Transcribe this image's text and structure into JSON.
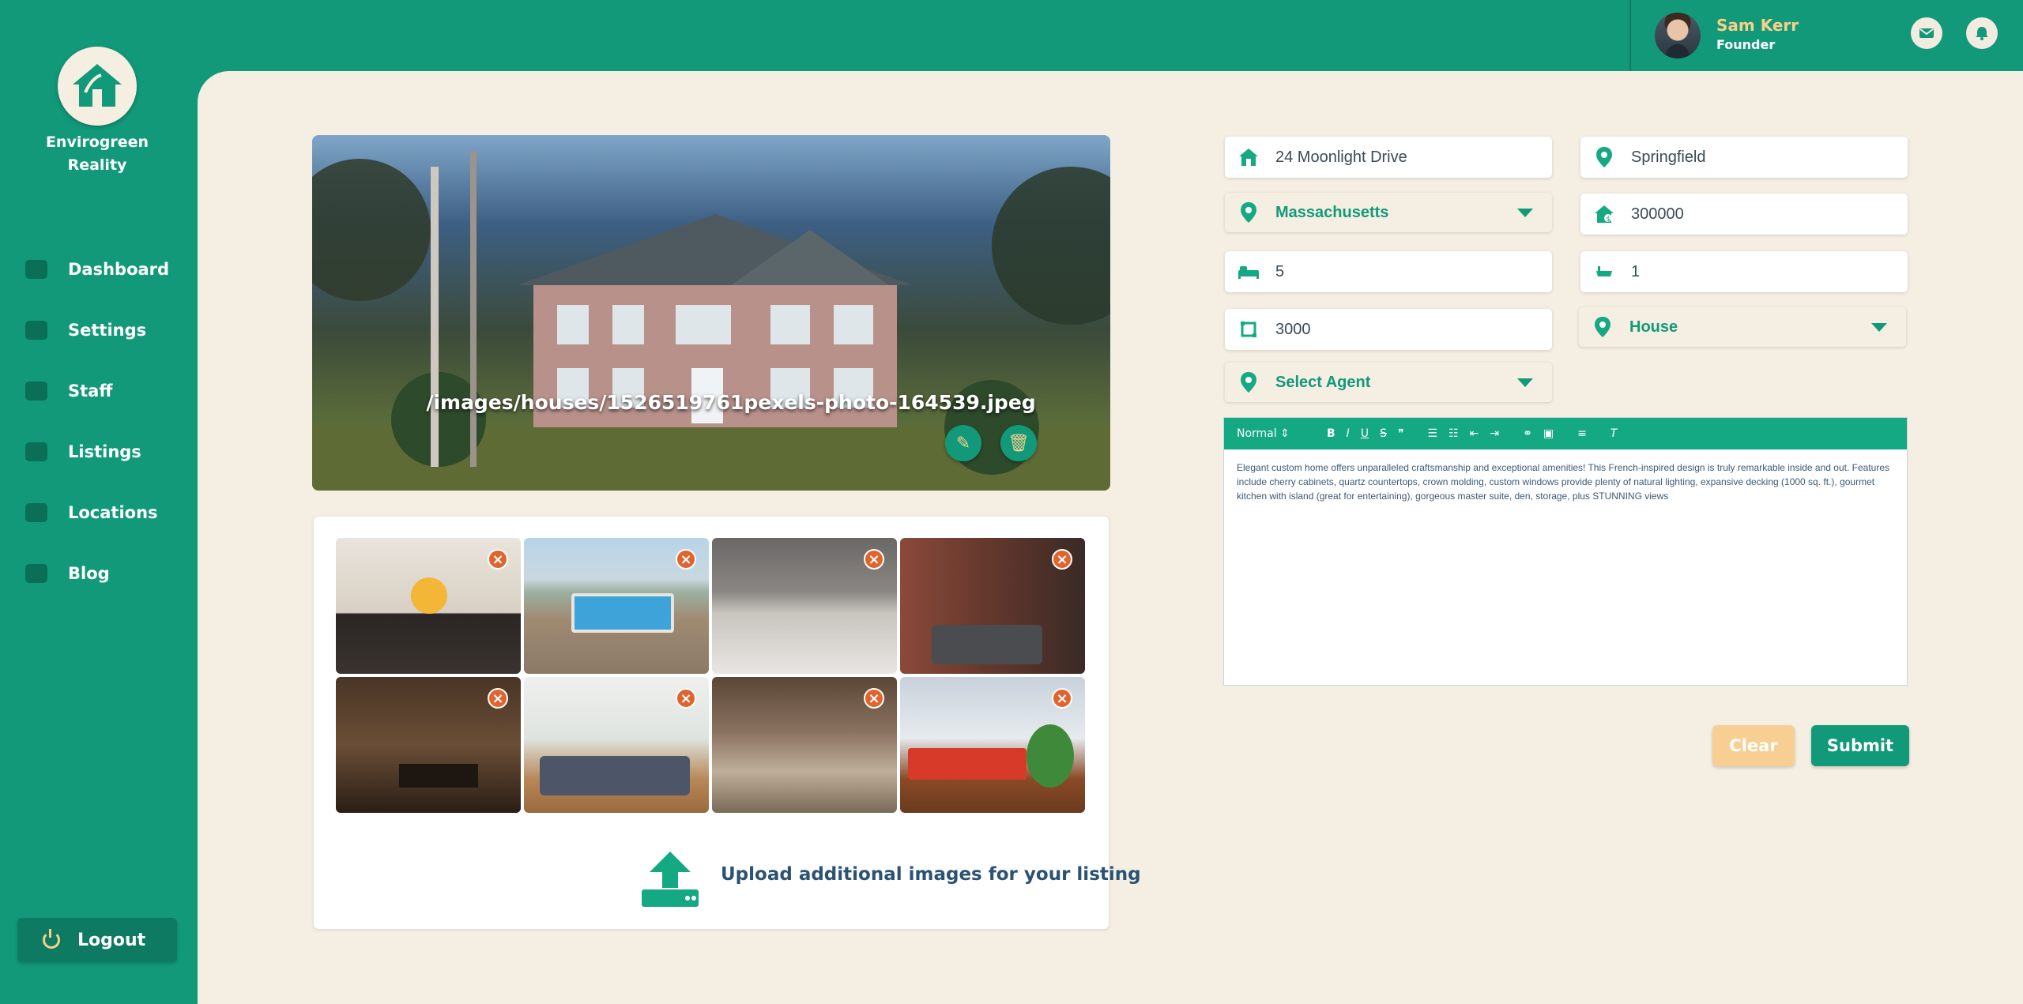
{
  "app": {
    "brand": "Envirogreen Reality",
    "brand_line1": "Envirogreen",
    "brand_line2": "Reality"
  },
  "user": {
    "name": "Sam Kerr",
    "role": "Founder"
  },
  "header_icons": [
    "mail-icon",
    "bell-icon"
  ],
  "sidebar": {
    "items": [
      {
        "label": "Dashboard",
        "icon": "dashboard-icon"
      },
      {
        "label": "Settings",
        "icon": "gear-icon"
      },
      {
        "label": "Staff",
        "icon": "user-icon"
      },
      {
        "label": "Listings",
        "icon": "house-icon"
      },
      {
        "label": "Locations",
        "icon": "map-icon"
      },
      {
        "label": "Blog",
        "icon": "blog-icon"
      }
    ],
    "logout_label": "Logout"
  },
  "hero": {
    "caption": "/images/houses/1526519761pexels-photo-164539.jpeg"
  },
  "gallery": {
    "thumbnails": [
      {
        "subject": "dining-room",
        "remove": "×"
      },
      {
        "subject": "swimming-pool",
        "remove": "×"
      },
      {
        "subject": "kitchen",
        "remove": "×"
      },
      {
        "subject": "living-room-brick",
        "remove": "×"
      },
      {
        "subject": "living-room-dark",
        "remove": "×"
      },
      {
        "subject": "living-room-bright",
        "remove": "×"
      },
      {
        "subject": "open-plan-room",
        "remove": "×"
      },
      {
        "subject": "red-sofa-room",
        "remove": "×"
      }
    ],
    "upload_label": "Upload additional images for your listing"
  },
  "form": {
    "address": "24 Moonlight Drive",
    "city": "Springfield",
    "state": "Massachusetts",
    "price": "300000",
    "bedrooms": "5",
    "bathrooms": "1",
    "sqft": "3000",
    "property_type": "House",
    "agent": "Select Agent"
  },
  "editor": {
    "format": "Normal",
    "text": "Elegant custom home offers unparalleled craftsmanship and exceptional amenities! This French-inspired design is truly remarkable inside and out. Features include cherry cabinets, quartz countertops, crown molding, custom windows provide plenty of natural lighting, expansive decking (1000 sq. ft.), gourmet kitchen with island (great for entertaining), gorgeous master suite, den, storage, plus STUNNING views"
  },
  "buttons": {
    "clear": "Clear",
    "submit": "Submit"
  },
  "colors": {
    "brand_green": "#12997a",
    "accent_gold": "#f8d08a",
    "background": "#f5efe3",
    "remove_orange": "#e0642e"
  }
}
